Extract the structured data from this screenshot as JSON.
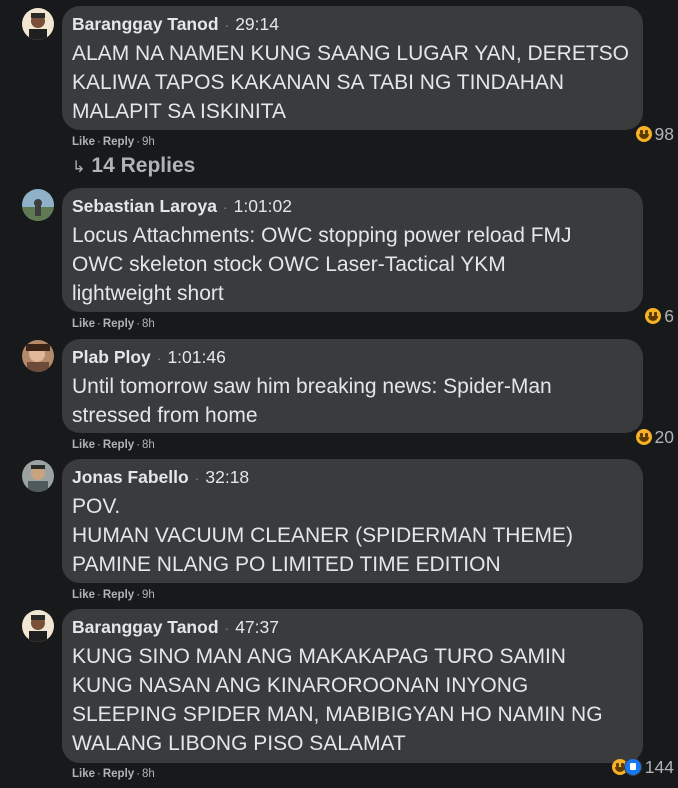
{
  "comments": [
    {
      "author": "Baranggay Tanod",
      "timestamp": "29:14",
      "text": "ALAM NA NAMEN KUNG SAANG LUGAR YAN, DERETSO\nKALIWA TAPOS KAKANAN SA TABI NG TINDAHAN\nMALAPIT SA ISKINITA",
      "reaction_count": "98",
      "like_label": "Like",
      "reply_label": "Reply",
      "age": "9h",
      "avatar_icon": "avatar-icon"
    },
    {
      "author": "Sebastian Laroya",
      "timestamp": "1:01:02",
      "text": "Locus Attachments: OWC stopping power reload FMJ\nOWC skeleton stock OWC Laser-Tactical YKM\nlightweight short",
      "reaction_count": "6",
      "like_label": "Like",
      "reply_label": "Reply",
      "age": "8h",
      "avatar_icon": "avatar-icon"
    },
    {
      "author": "Plab Ploy",
      "timestamp": "1:01:46",
      "text": "Until tomorrow saw him breaking news: Spider-Man\nstressed from home",
      "reaction_count": "20",
      "like_label": "Like",
      "reply_label": "Reply",
      "age": "8h",
      "avatar_icon": "avatar-icon"
    },
    {
      "author": "Jonas Fabello",
      "timestamp": "32:18",
      "text": "POV.\nHUMAN VACUUM CLEANER (SPIDERMAN THEME)\nPAMINE NLANG PO LIMITED TIME EDITION",
      "reaction_count": "",
      "like_label": "Like",
      "reply_label": "Reply",
      "age": "9h",
      "avatar_icon": "avatar-icon"
    },
    {
      "author": "Baranggay Tanod",
      "timestamp": "47:37",
      "text": "KUNG SINO MAN ANG MAKAKAPAG TURO SAMIN\nKUNG NASAN ANG KINAROROONAN INYONG\nSLEEPING SPIDER MAN, MABIBIGYAN HO NAMIN NG\nWALANG LIBONG PISO SALAMAT",
      "reaction_count": "144",
      "like_label": "Like",
      "reply_label": "Reply",
      "age": "8h",
      "avatar_icon": "avatar-icon"
    }
  ],
  "replies_link": "14 Replies",
  "replies_icon": "reply-arrow-icon",
  "reaction_icons": [
    "haha-icon",
    "like-icon"
  ],
  "colors": {
    "background": "#18191a",
    "bubble": "#3a3b3c",
    "text": "#e4e6eb",
    "secondary": "#b0b3b8",
    "haha": "#f7b125",
    "like": "#1877f2"
  }
}
